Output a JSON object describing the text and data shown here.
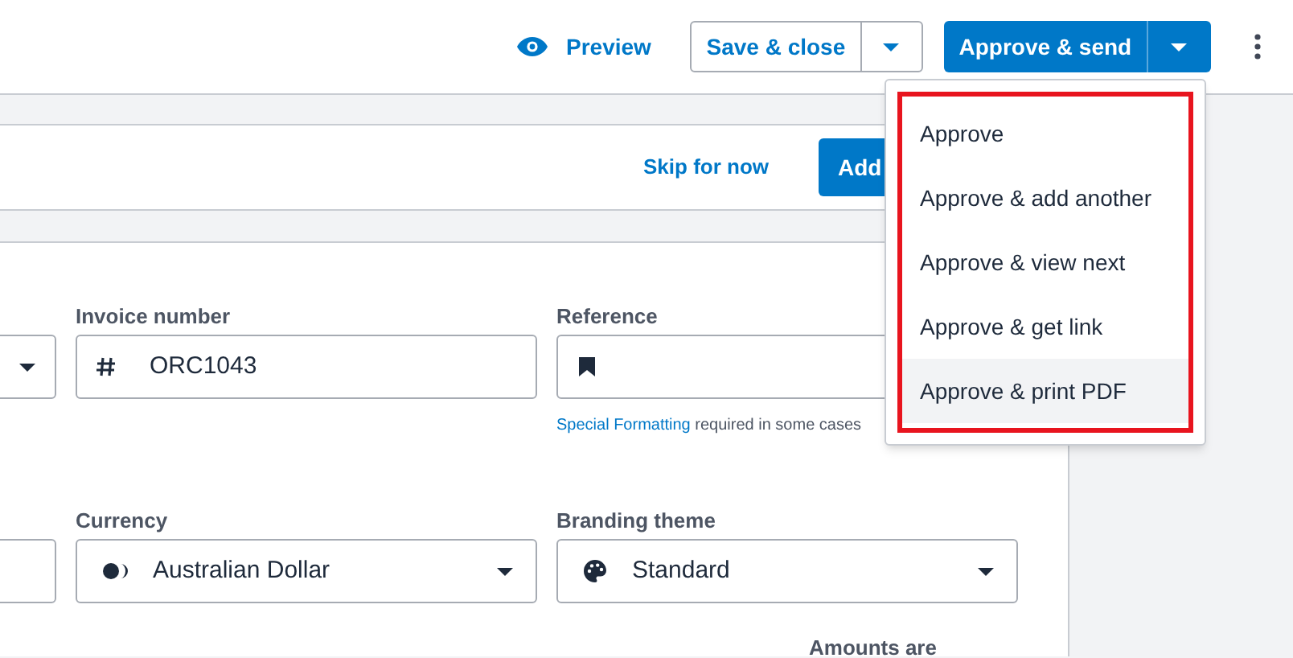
{
  "toolbar": {
    "preview": "Preview",
    "save_button": "Save & close",
    "approve_button": "Approve & send"
  },
  "banner": {
    "skip_link": "Skip for now",
    "add_button": "Add"
  },
  "form": {
    "invoice_number": {
      "label": "Invoice number",
      "value": "ORC1043"
    },
    "reference": {
      "label": "Reference",
      "note_link": "Special Formatting",
      "note": "required in some cases"
    },
    "currency": {
      "label": "Currency",
      "value": "Australian Dollar"
    },
    "branding_theme": {
      "label": "Branding theme",
      "value": "Standard"
    },
    "amounts_label": "Amounts are"
  },
  "approve_menu": [
    {
      "label": "Approve",
      "selected": false
    },
    {
      "label": "Approve & add another",
      "selected": false
    },
    {
      "label": "Approve & view next",
      "selected": false
    },
    {
      "label": "Approve & get link",
      "selected": false
    },
    {
      "label": "Approve & print PDF",
      "selected": true
    }
  ]
}
